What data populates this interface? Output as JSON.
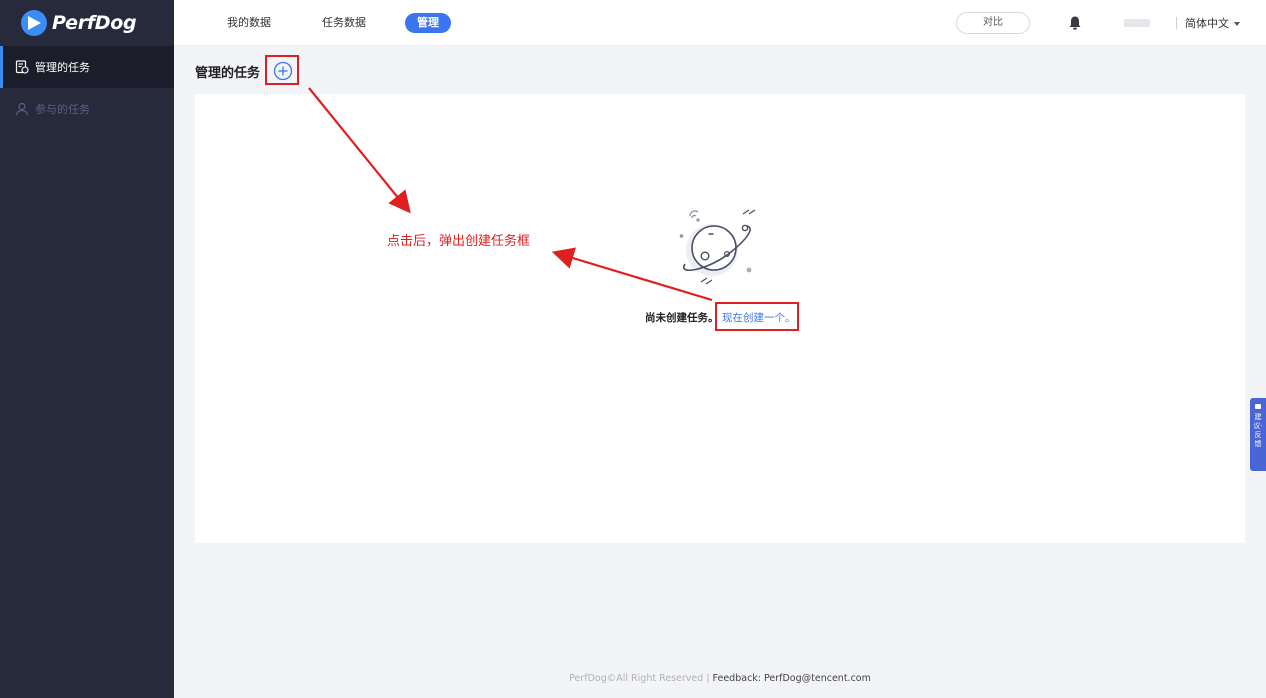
{
  "app": {
    "logo_text": "PerfDog"
  },
  "sidebar": {
    "items": [
      {
        "label": "管理的任务",
        "active": true,
        "icon": "task-doc-icon"
      },
      {
        "label": "参与的任务",
        "active": false,
        "icon": "people-icon"
      }
    ]
  },
  "topbar": {
    "tabs": [
      {
        "label": "我的数据"
      },
      {
        "label": "任务数据"
      },
      {
        "label": "管理",
        "active": true
      }
    ],
    "compare_label": "对比",
    "language_label": "简体中文"
  },
  "page": {
    "title": "管理的任务"
  },
  "empty_state": {
    "message": "尚未创建任务。",
    "create_link": "现在创建一个。"
  },
  "annotation": {
    "text": "点击后，弹出创建任务框"
  },
  "float_tab": {
    "label": "建议·反馈"
  },
  "footer": {
    "copyright": "PerfDog©All Right Reserved | ",
    "feedback": "Feedback: PerfDog@tencent.com"
  },
  "colors": {
    "sidebar_bg": "#272a3a",
    "accent": "#3b76f0",
    "annotation_red": "#e02020"
  }
}
